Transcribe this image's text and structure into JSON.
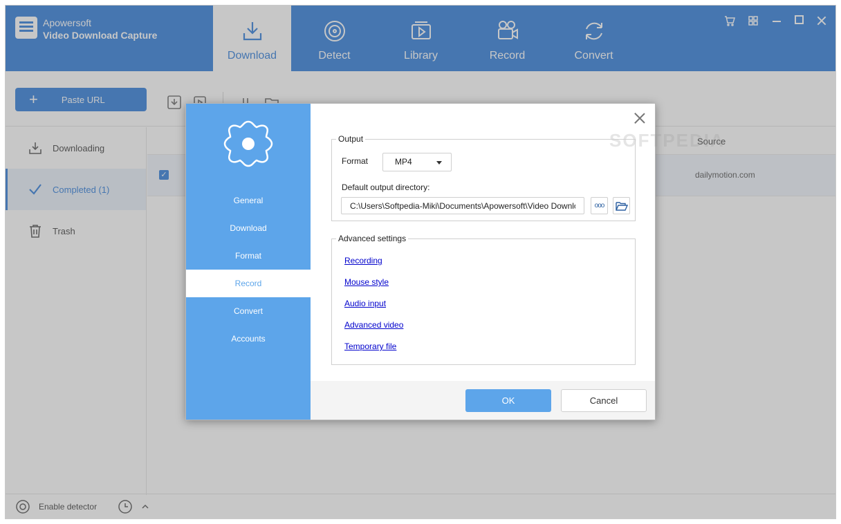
{
  "app": {
    "brand_line1": "Apowersoft",
    "brand_line2": "Video Download Capture",
    "nav": [
      {
        "label": "Download",
        "icon": "download-icon",
        "active": true
      },
      {
        "label": "Detect",
        "icon": "detect-icon"
      },
      {
        "label": "Library",
        "icon": "library-icon"
      },
      {
        "label": "Record",
        "icon": "record-icon"
      },
      {
        "label": "Convert",
        "icon": "convert-icon"
      }
    ],
    "window_controls": [
      "cart-icon",
      "grid-icon",
      "minimize-icon",
      "maximize-icon",
      "close-icon"
    ],
    "toolbar": {
      "paste_label": "Paste URL"
    },
    "sidebar": [
      {
        "label": "Downloading",
        "icon": "download-icon"
      },
      {
        "label": "Completed (1)",
        "icon": "check-icon",
        "active": true
      },
      {
        "label": "Trash",
        "icon": "trash-icon"
      }
    ],
    "table": {
      "col_source": "Source",
      "rows": [
        {
          "source": "dailymotion.com",
          "checked": true
        }
      ]
    },
    "status": {
      "detector_label": "Enable detector"
    }
  },
  "dialog": {
    "tabs": [
      "General",
      "Download",
      "Format",
      "Record",
      "Convert",
      "Accounts"
    ],
    "active_tab": "Record",
    "watermark": "SOFTPEDIA",
    "output": {
      "title": "Output",
      "format_label": "Format",
      "format_value": "MP4",
      "dir_label": "Default output directory:",
      "dir_value": "C:\\Users\\Softpedia-Miki\\Documents\\Apowersoft\\Video Download Capture",
      "more_label": "ooo"
    },
    "advanced": {
      "title": "Advanced settings",
      "links": [
        "Recording",
        "Mouse style",
        "Audio input",
        "Advanced video",
        "Temporary file"
      ]
    },
    "ok_label": "OK",
    "cancel_label": "Cancel"
  },
  "colors": {
    "accent": "#5a98e2",
    "dialog_sidebar": "#5da5ea",
    "link": "#0000cc"
  }
}
